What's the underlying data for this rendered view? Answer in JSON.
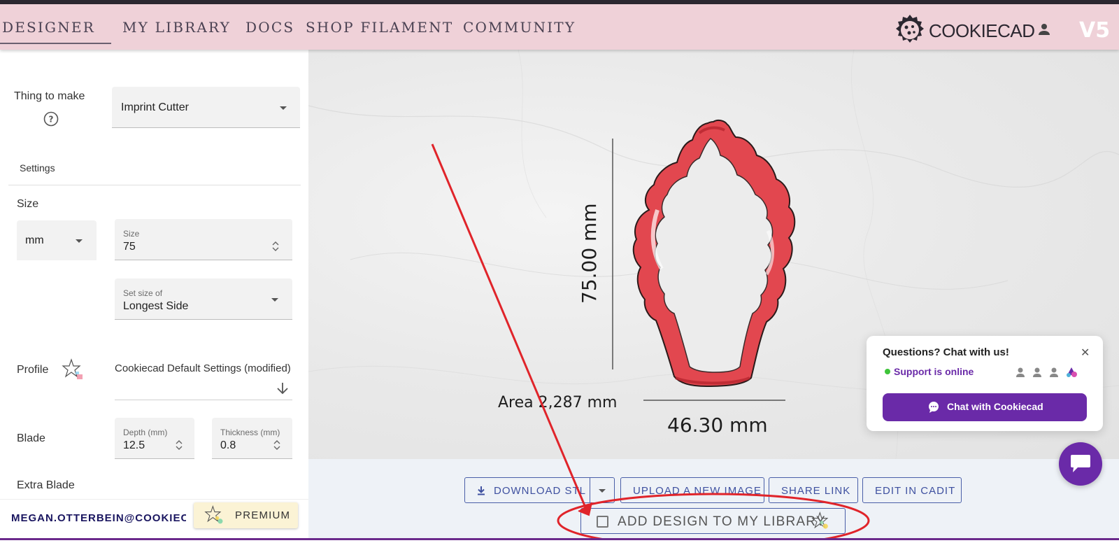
{
  "nav": {
    "items": [
      "DESIGNER",
      "MY LIBRARY",
      "DOCS",
      "SHOP FILAMENT",
      "COMMUNITY"
    ],
    "active": "DESIGNER",
    "brand": "COOKIECAD",
    "version": "V5"
  },
  "sidebar": {
    "thing_to_make_label": "Thing to make",
    "thing_to_make_value": "Imprint Cutter",
    "settings_label": "Settings",
    "size_section_label": "Size",
    "unit_value": "mm",
    "size_field_label": "Size",
    "size_field_value": "75",
    "set_size_of_label": "Set size of",
    "set_size_of_value": "Longest Side",
    "profile_label": "Profile",
    "profile_value": "Cookiecad Default Settings (modified)",
    "blade_label": "Blade",
    "depth_label": "Depth (mm)",
    "depth_value": "12.5",
    "thickness_label": "Thickness (mm)",
    "thickness_value": "0.8",
    "extra_blade_label": "Extra Blade",
    "user_email": "MEGAN.OTTERBEIN@COOKIEC…",
    "premium_label": "PREMIUM"
  },
  "viewer": {
    "height_dim": "75.00 mm",
    "width_dim": "46.30 mm",
    "area_text": "Area 2,287 mm",
    "shape_color": "#e2474f"
  },
  "actions": {
    "download": "DOWNLOAD STL",
    "upload": "UPLOAD A NEW IMAGE",
    "share": "SHARE LINK",
    "edit": "EDIT IN CADIT",
    "add_to_library": "ADD DESIGN TO MY LIBRARY",
    "add_to_library_checked": false
  },
  "chat": {
    "title": "Questions? Chat with us!",
    "status": "Support is online",
    "button": "Chat with Cookiecad"
  },
  "colors": {
    "nav_bg": "#efd1d8",
    "accent": "#6a2aa8",
    "button_border": "#4a5fa8",
    "annotation": "#e0242a"
  }
}
